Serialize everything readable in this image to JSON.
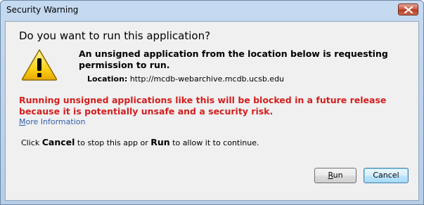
{
  "window": {
    "title": "Security Warning",
    "close_icon": "close-icon"
  },
  "dialog": {
    "heading": "Do you want to run this application?",
    "warning_icon": "warning-triangle-icon",
    "description": "An unsigned application from the location below is requesting permission to run.",
    "location_label": "Location:",
    "location_value": "http://mcdb-webarchive.mcdb.ucsb.edu",
    "red_warning": "Running unsigned applications like this will be blocked in a future release because it is potentially unsafe and a security risk.",
    "more_info_first": "M",
    "more_info_rest": "ore Information",
    "instructions": {
      "part1": "Click ",
      "cancel_word": "Cancel",
      "part2": " to stop this app or ",
      "run_word": "Run",
      "part3": " to allow it to continue."
    }
  },
  "buttons": {
    "run_first": "R",
    "run_rest": "un",
    "cancel_label": "Cancel"
  },
  "colors": {
    "red_text": "#d21f1f",
    "link": "#335ea8",
    "title_bar": "#c5daf0",
    "client_bg": "#f0f0f0"
  }
}
